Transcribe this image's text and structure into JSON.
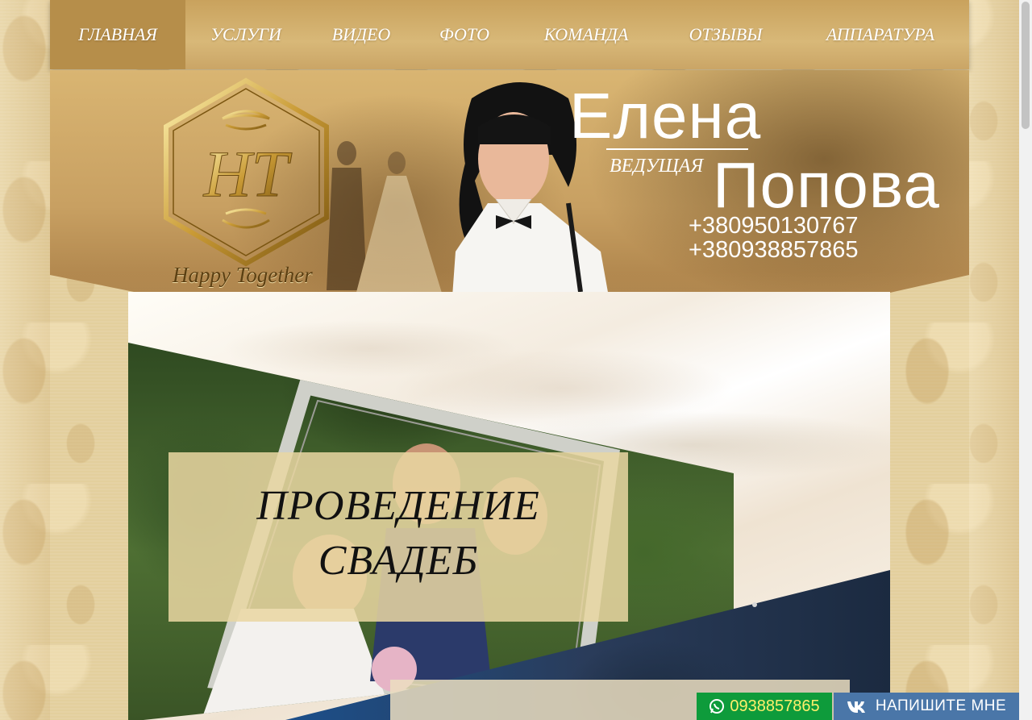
{
  "nav": {
    "items": [
      {
        "label": "ГЛАВНАЯ",
        "active": true
      },
      {
        "label": "УСЛУГИ",
        "active": false
      },
      {
        "label": "ВИДЕО",
        "active": false
      },
      {
        "label": "ФОТО",
        "active": false
      },
      {
        "label": "КОМАНДА",
        "active": false
      },
      {
        "label": "ОТЗЫВЫ",
        "active": false
      },
      {
        "label": "АППАРАТУРА",
        "active": false
      }
    ]
  },
  "logo": {
    "monogram": "HT",
    "script": "Happy Together"
  },
  "host": {
    "first_name": "Елена",
    "role": "ВЕДУЩАЯ",
    "last_name": "Попова",
    "phones": [
      "+380950130767",
      "+380938857865"
    ]
  },
  "slider": {
    "caption_line1": "ПРОВЕДЕНИЕ",
    "caption_line2": "СВАДЕБ"
  },
  "contact": {
    "whatsapp_number": "0938857865",
    "vk_label": "НАПИШИТЕ МНЕ"
  },
  "colors": {
    "nav_bg": "#d1ad6e",
    "nav_active": "#b68e4a",
    "whatsapp_bg": "#0e9b3b",
    "whatsapp_text": "#ffef6b",
    "vk_bg": "#4a76a8"
  }
}
